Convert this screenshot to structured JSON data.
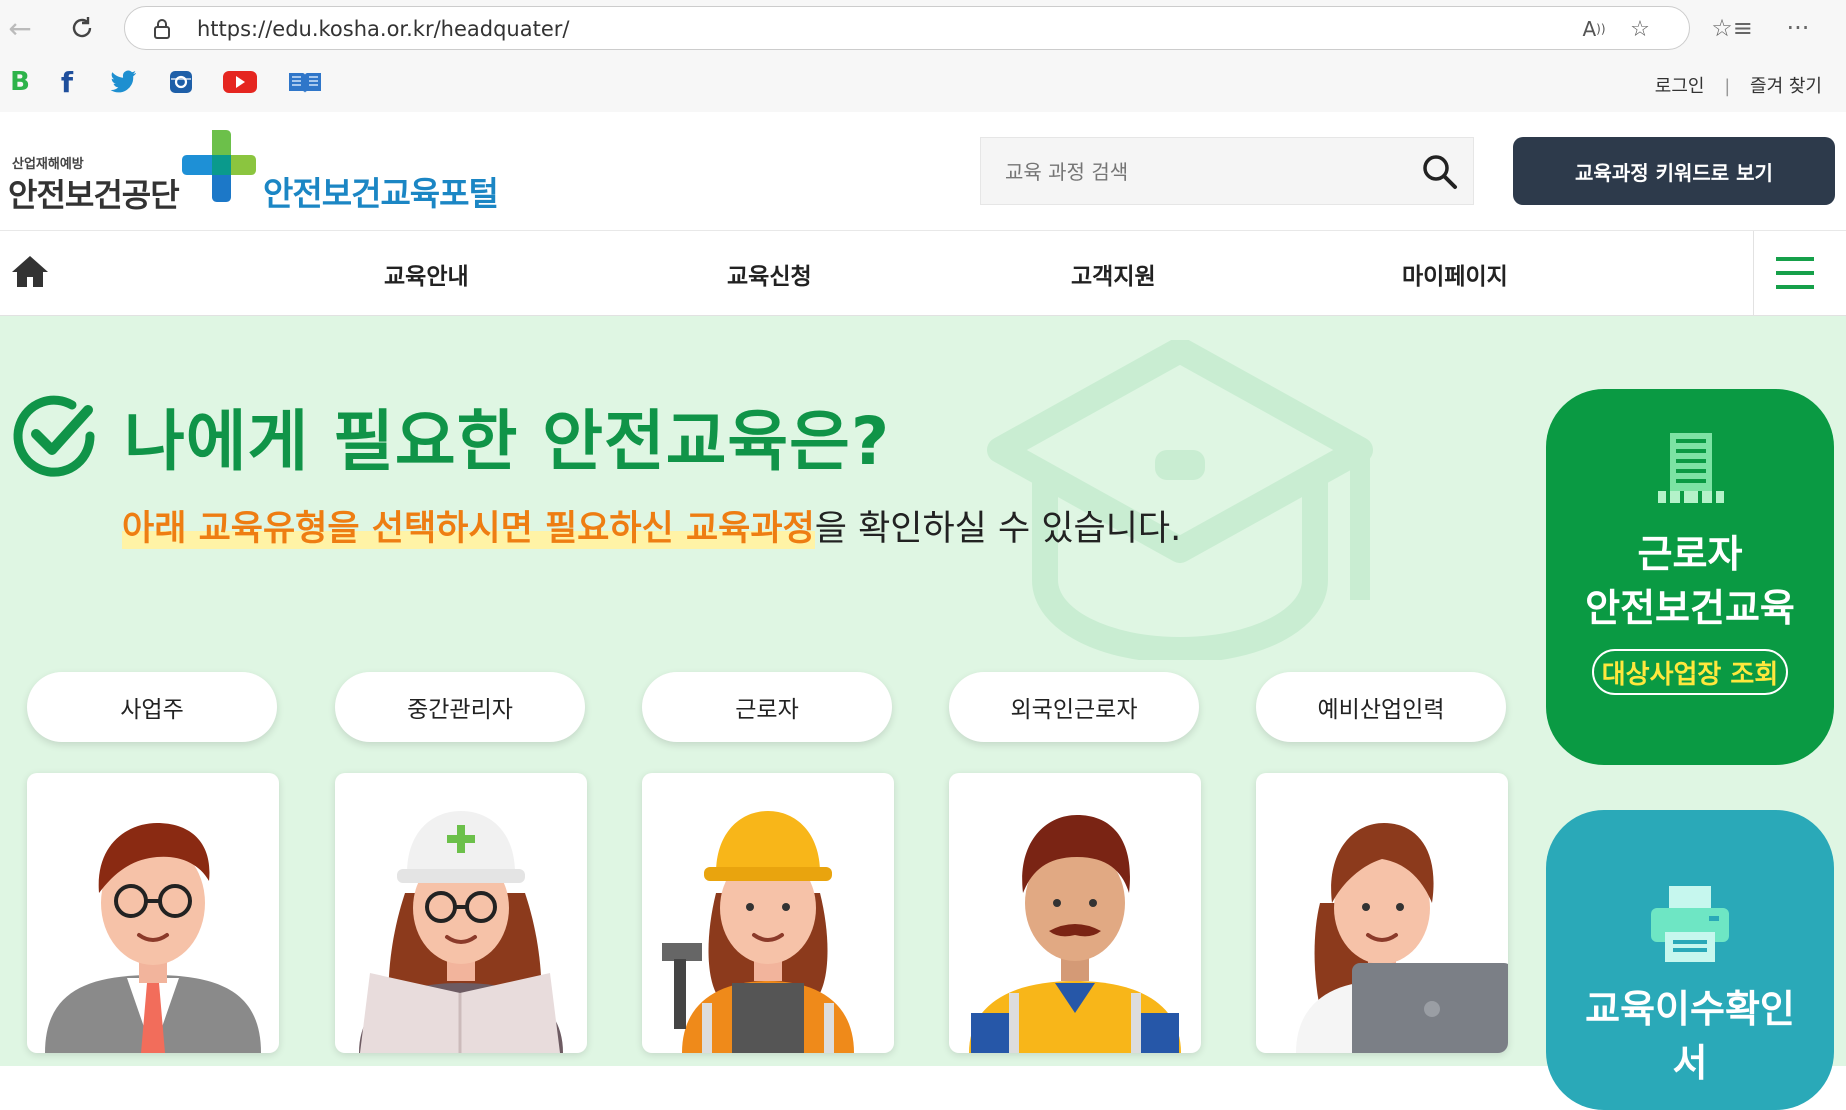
{
  "browser": {
    "url": "https://edu.kosha.or.kr/headquater/",
    "back_icon": "arrow-left-icon",
    "reload_icon": "reload-icon",
    "read_aloud_icon": "read-aloud-icon",
    "favorite_icon": "star-icon",
    "favorites_list_icon": "favorites-list-icon",
    "menu_icon": "more-dots-icon"
  },
  "social": {
    "items": [
      "blog-icon",
      "facebook-icon",
      "twitter-icon",
      "instagram-icon",
      "youtube-icon",
      "book-icon"
    ],
    "blog_letter": "B",
    "facebook_letter": "f",
    "login": "로그인",
    "favorites": "즐겨 찾기",
    "separator": "|"
  },
  "header": {
    "org_small": "산업재해예방",
    "org_name": "안전보건공단",
    "portal_name": "안전보건교육포털",
    "search_placeholder": "교육 과정 검색",
    "keyword_button": "교육과정 키워드로 보기"
  },
  "nav": {
    "items": [
      "교육안내",
      "교육신청",
      "고객지원",
      "마이페이지"
    ]
  },
  "hero": {
    "title": "나에게 필요한 안전교육은?",
    "subtitle_highlight": "아래 교육유형을 선택하시면 필요하신 교육과정",
    "subtitle_rest": "을 확인하실 수 있습니다.",
    "tabs": [
      "사업주",
      "중간관리자",
      "근로자",
      "외국인근로자",
      "예비산업인력"
    ]
  },
  "side": {
    "green_line1": "근로자",
    "green_line2": "안전보건교육",
    "green_badge": "대상사업장 조회",
    "teal_line1": "교육이수확인",
    "teal_line2": "서"
  },
  "colors": {
    "brand_green": "#109448",
    "side_green": "#0a9a43",
    "side_teal": "#2aa9b8",
    "keyword_button": "#2d3a4b",
    "highlight_orange": "#ee7d12",
    "hero_bg": "#dff6e3"
  }
}
